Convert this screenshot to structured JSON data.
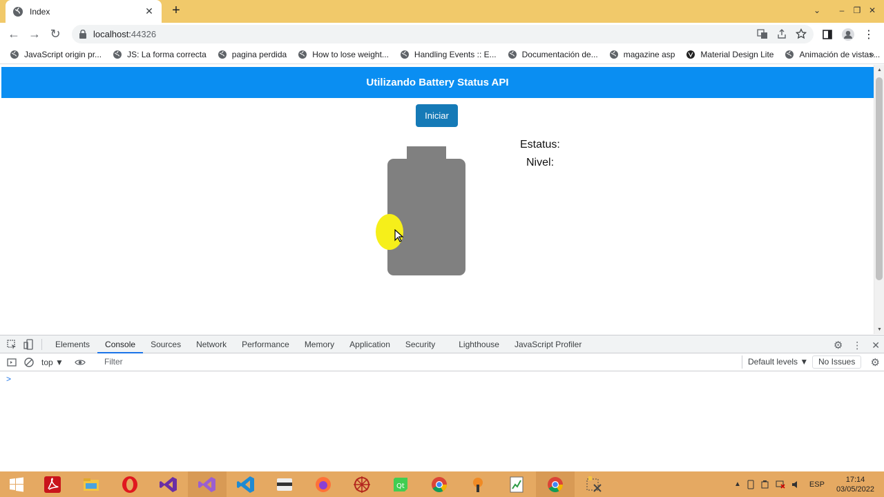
{
  "browser": {
    "tab_title": "Index",
    "url_host": "localhost:",
    "url_port": "44326",
    "bookmarks": [
      "JavaScript origin pr...",
      "JS: La forma correcta",
      "pagina perdida",
      "How to lose weight...",
      "Handling Events :: E...",
      "Documentación de...",
      "magazine asp",
      "Material Design Lite",
      "Animación de vistas..."
    ],
    "bookmarks_more": "»"
  },
  "page": {
    "header_title": "Utilizando Battery Status API",
    "start_button": "Iniciar",
    "status_label": "Estatus:",
    "level_label": "Nivel:"
  },
  "devtools": {
    "tabs": [
      "Elements",
      "Console",
      "Sources",
      "Network",
      "Performance",
      "Memory",
      "Application",
      "Security",
      "Lighthouse",
      "JavaScript Profiler"
    ],
    "active_tab": "Console",
    "context": "top ▼",
    "filter_placeholder": "Filter",
    "default_levels": "Default levels ▼",
    "issues": "No Issues",
    "prompt": ">"
  },
  "taskbar": {
    "language": "ESP",
    "time": "17:14",
    "date": "03/05/2022"
  },
  "colors": {
    "tabstrip": "#f1c96a",
    "header": "#0a8ef2",
    "button": "#157ab7",
    "battery": "#808080",
    "taskbar": "#e5a962"
  }
}
